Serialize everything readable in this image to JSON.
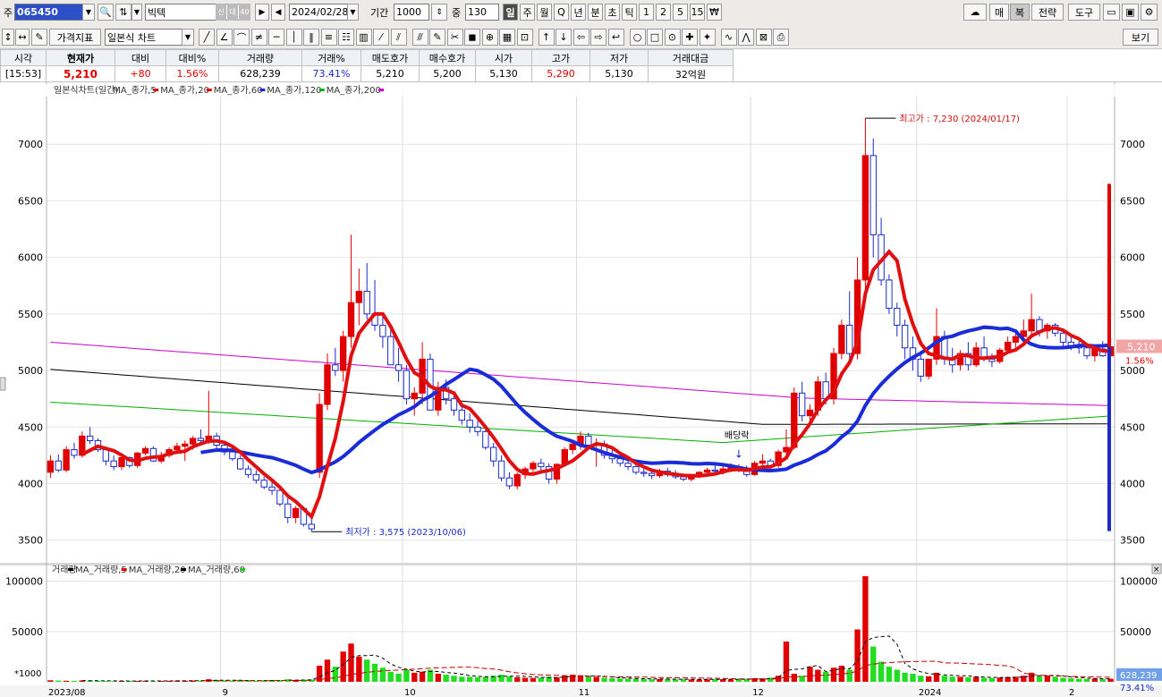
{
  "toolbar": {
    "market_label": "주",
    "code": "065450",
    "name": "빅텍",
    "badges": [
      "신",
      "대",
      "40"
    ],
    "date": "2024/02/28",
    "period_label": "기간",
    "period_value": "1000",
    "count_label": "중",
    "count_value": "130",
    "timeframes": [
      "일",
      "주",
      "월",
      "Q",
      "년",
      "분",
      "초",
      "틱",
      "1",
      "2",
      "5",
      "15",
      "₩"
    ],
    "active_timeframe": "일",
    "right_buttons": [
      "매",
      "복",
      "전략",
      "도구"
    ],
    "indicator_btn": "가격지표",
    "chart_type": "일본식 차트",
    "view_btn": "보기"
  },
  "quote": {
    "headers": [
      "시각",
      "현재가",
      "대비",
      "대비%",
      "거래량",
      "거래%",
      "매도호가",
      "매수호가",
      "시가",
      "고가",
      "저가",
      "거래대금"
    ],
    "values": [
      "[15:53]",
      "5,210",
      "+80",
      "1.56%",
      "628,239",
      "73.41%",
      "5,210",
      "5,200",
      "5,130",
      "5,290",
      "5,130",
      "32억원"
    ]
  },
  "chart_data": {
    "type": "candlestick",
    "price_legend": [
      "일본식차트(일간)",
      "MA_종가,5",
      "MA_종가,20",
      "MA_종가,60",
      "MA_종가,120",
      "MA_종가,200"
    ],
    "volume_legend": [
      "거래량",
      "MA_거래량,5",
      "MA_거래량,20",
      "MA_거래량,60"
    ],
    "price_ticks": [
      3500,
      4000,
      4500,
      5000,
      5500,
      6000,
      6500,
      7000
    ],
    "volume_ticks": [
      "50000",
      "100000"
    ],
    "volume_unit": "*1000",
    "x_labels": [
      "2023/08",
      "9",
      "10",
      "11",
      "12",
      "2024",
      "2"
    ],
    "high_note": "최고가 : 7,230 (2024/01/17)",
    "low_note": "최저가 : 3,575 (2023/10/06)",
    "dividend_note": "배당락",
    "current_price": "5,210",
    "current_pct": "1.56%",
    "current_volume": "628,239",
    "current_volume_pct": "73.41%",
    "ohlc": [
      [
        4100,
        4250,
        4050,
        4200
      ],
      [
        4200,
        4260,
        4100,
        4120
      ],
      [
        4120,
        4330,
        4100,
        4300
      ],
      [
        4300,
        4360,
        4220,
        4250
      ],
      [
        4250,
        4460,
        4230,
        4420
      ],
      [
        4420,
        4500,
        4350,
        4380
      ],
      [
        4380,
        4400,
        4280,
        4300
      ],
      [
        4300,
        4330,
        4160,
        4200
      ],
      [
        4200,
        4250,
        4120,
        4150
      ],
      [
        4150,
        4250,
        4120,
        4230
      ],
      [
        4230,
        4240,
        4140,
        4160
      ],
      [
        4160,
        4280,
        4140,
        4270
      ],
      [
        4270,
        4330,
        4250,
        4310
      ],
      [
        4310,
        4330,
        4190,
        4200
      ],
      [
        4200,
        4280,
        4180,
        4250
      ],
      [
        4250,
        4320,
        4230,
        4300
      ],
      [
        4300,
        4360,
        4270,
        4330
      ],
      [
        4330,
        4380,
        4200,
        4350
      ],
      [
        4350,
        4420,
        4300,
        4400
      ],
      [
        4400,
        4480,
        4350,
        4380
      ],
      [
        4380,
        4820,
        4350,
        4420
      ],
      [
        4420,
        4450,
        4300,
        4340
      ],
      [
        4340,
        4380,
        4250,
        4280
      ],
      [
        4280,
        4310,
        4200,
        4220
      ],
      [
        4220,
        4250,
        4120,
        4130
      ],
      [
        4130,
        4160,
        4050,
        4080
      ],
      [
        4080,
        4120,
        4000,
        4030
      ],
      [
        4030,
        4060,
        3950,
        3970
      ],
      [
        3970,
        4010,
        3900,
        3940
      ],
      [
        3940,
        3980,
        3800,
        3820
      ],
      [
        3820,
        3880,
        3650,
        3700
      ],
      [
        3700,
        3800,
        3650,
        3780
      ],
      [
        3780,
        3800,
        3620,
        3640
      ],
      [
        3640,
        3700,
        3575,
        3600
      ],
      [
        4100,
        4800,
        4050,
        4700
      ],
      [
        4700,
        5150,
        4650,
        5050
      ],
      [
        5050,
        5200,
        4950,
        5000
      ],
      [
        5000,
        5350,
        4900,
        5300
      ],
      [
        5300,
        6200,
        5200,
        5600
      ],
      [
        5600,
        5900,
        5400,
        5700
      ],
      [
        5700,
        5950,
        5450,
        5500
      ],
      [
        5500,
        5800,
        5350,
        5400
      ],
      [
        5400,
        5500,
        5200,
        5300
      ],
      [
        5300,
        5400,
        5100,
        5050
      ],
      [
        5050,
        5200,
        4900,
        5000
      ],
      [
        5000,
        5050,
        4700,
        4750
      ],
      [
        4750,
        4850,
        4600,
        4800
      ],
      [
        4800,
        5250,
        4700,
        5100
      ],
      [
        5100,
        5150,
        4700,
        4650
      ],
      [
        4650,
        4900,
        4600,
        4850
      ],
      [
        4850,
        4920,
        4700,
        4750
      ],
      [
        4750,
        4800,
        4600,
        4650
      ],
      [
        4650,
        4700,
        4520,
        4560
      ],
      [
        4560,
        4620,
        4450,
        4500
      ],
      [
        4500,
        4560,
        4420,
        4460
      ],
      [
        4460,
        4480,
        4300,
        4320
      ],
      [
        4320,
        4360,
        4150,
        4200
      ],
      [
        4200,
        4250,
        4020,
        4050
      ],
      [
        4050,
        4100,
        3950,
        3980
      ],
      [
        3980,
        4100,
        3950,
        4080
      ],
      [
        4080,
        4150,
        4040,
        4130
      ],
      [
        4130,
        4200,
        4100,
        4180
      ],
      [
        4180,
        4220,
        4100,
        4150
      ],
      [
        4150,
        4180,
        4000,
        4040
      ],
      [
        4040,
        4180,
        4000,
        4170
      ],
      [
        4170,
        4320,
        4150,
        4300
      ],
      [
        4300,
        4380,
        4260,
        4350
      ],
      [
        4350,
        4460,
        4300,
        4420
      ],
      [
        4420,
        4450,
        4320,
        4340
      ],
      [
        4340,
        4400,
        4150,
        4350
      ],
      [
        4350,
        4380,
        4220,
        4250
      ],
      [
        4250,
        4300,
        4180,
        4220
      ],
      [
        4220,
        4260,
        4150,
        4180
      ],
      [
        4180,
        4220,
        4120,
        4150
      ],
      [
        4150,
        4180,
        4080,
        4100
      ],
      [
        4100,
        4140,
        4060,
        4090
      ],
      [
        4090,
        4120,
        4040,
        4070
      ],
      [
        4070,
        4130,
        4050,
        4110
      ],
      [
        4110,
        4140,
        4060,
        4080
      ],
      [
        4080,
        4120,
        4040,
        4060
      ],
      [
        4060,
        4090,
        4020,
        4040
      ],
      [
        4040,
        4080,
        4020,
        4060
      ],
      [
        4060,
        4110,
        4050,
        4100
      ],
      [
        4100,
        4140,
        4080,
        4120
      ],
      [
        4120,
        4160,
        4090,
        4110
      ],
      [
        4110,
        4150,
        4080,
        4130
      ],
      [
        4130,
        4180,
        4100,
        4150
      ],
      [
        4150,
        4170,
        4100,
        4120
      ],
      [
        4120,
        4160,
        4060,
        4080
      ],
      [
        4080,
        4200,
        4070,
        4180
      ],
      [
        4180,
        4260,
        4150,
        4200
      ],
      [
        4200,
        4220,
        4140,
        4160
      ],
      [
        4160,
        4300,
        4140,
        4280
      ],
      [
        4280,
        4480,
        4250,
        4320
      ],
      [
        4320,
        4850,
        4300,
        4800
      ],
      [
        4800,
        4900,
        4550,
        4600
      ],
      [
        4600,
        4700,
        4550,
        4650
      ],
      [
        4650,
        4950,
        4600,
        4900
      ],
      [
        4900,
        4980,
        4700,
        4750
      ],
      [
        4750,
        5200,
        4700,
        5150
      ],
      [
        5150,
        5450,
        5100,
        5400
      ],
      [
        5400,
        5700,
        5100,
        5150
      ],
      [
        5150,
        6000,
        5100,
        5800
      ],
      [
        5800,
        7230,
        5700,
        6900
      ],
      [
        6900,
        7050,
        6000,
        6200
      ],
      [
        6200,
        6350,
        5750,
        5800
      ],
      [
        5800,
        5850,
        5500,
        5550
      ],
      [
        5550,
        5600,
        5300,
        5400
      ],
      [
        5400,
        5450,
        5100,
        5200
      ],
      [
        5200,
        5300,
        5000,
        5100
      ],
      [
        5100,
        5150,
        4900,
        4950
      ],
      [
        4950,
        5100,
        4920,
        5100
      ],
      [
        5100,
        5550,
        5050,
        5300
      ],
      [
        5300,
        5350,
        5050,
        5100
      ],
      [
        5100,
        5200,
        4980,
        5050
      ],
      [
        5050,
        5180,
        5000,
        5150
      ],
      [
        5150,
        5250,
        5000,
        5050
      ],
      [
        5050,
        5250,
        5030,
        5200
      ],
      [
        5200,
        5300,
        5080,
        5100
      ],
      [
        5100,
        5150,
        5030,
        5080
      ],
      [
        5080,
        5200,
        5060,
        5180
      ],
      [
        5180,
        5300,
        5150,
        5250
      ],
      [
        5250,
        5350,
        5200,
        5300
      ],
      [
        5300,
        5450,
        5250,
        5350
      ],
      [
        5350,
        5680,
        5300,
        5450
      ],
      [
        5450,
        5480,
        5300,
        5350
      ],
      [
        5350,
        5420,
        5280,
        5400
      ],
      [
        5400,
        5420,
        5300,
        5330
      ],
      [
        5330,
        5350,
        5200,
        5250
      ],
      [
        5250,
        5300,
        5180,
        5220
      ],
      [
        5220,
        5260,
        5150,
        5200
      ],
      [
        5200,
        5240,
        5100,
        5130
      ],
      [
        5130,
        5220,
        5080,
        5190
      ],
      [
        5190,
        5260,
        5120,
        5130
      ],
      [
        5130,
        5290,
        5130,
        5210
      ]
    ],
    "volume": [
      1500,
      1200,
      1000,
      900,
      1400,
      1100,
      900,
      800,
      700,
      900,
      800,
      900,
      1000,
      800,
      900,
      1000,
      1200,
      1100,
      1300,
      1200,
      2500,
      1500,
      1200,
      1100,
      1300,
      1200,
      1100,
      1300,
      1200,
      1500,
      2500,
      1800,
      2000,
      2200,
      16000,
      22000,
      15000,
      30000,
      38000,
      25000,
      22000,
      18000,
      14000,
      10000,
      8000,
      12000,
      9000,
      10000,
      12000,
      8000,
      7000,
      6000,
      5000,
      5000,
      4500,
      5000,
      6000,
      7000,
      5500,
      4500,
      4000,
      3800,
      4000,
      5000,
      4500,
      6000,
      7000,
      6500,
      5000,
      4500,
      4000,
      3500,
      3200,
      3000,
      3200,
      2800,
      2500,
      2700,
      2600,
      2400,
      2500,
      2300,
      2200,
      2400,
      2500,
      2600,
      2300,
      2400,
      3000,
      3500,
      3200,
      4000,
      6000,
      40000,
      8000,
      6000,
      15000,
      12000,
      10000,
      14000,
      16000,
      12000,
      52000,
      105000,
      35000,
      20000,
      15000,
      12000,
      9000,
      8000,
      6000,
      5500,
      9000,
      6000,
      5000,
      5000,
      4500,
      5000,
      4000,
      3800,
      4200,
      4800,
      5000,
      6000,
      9000,
      5500,
      6000,
      5000,
      4000,
      3500,
      3000,
      2800,
      3200,
      2600,
      3000
    ],
    "colors": {
      "up": "#e00000",
      "down": "#1a2bc8",
      "ma5": "#e01010",
      "ma20": "#e01010",
      "ma60": "#1a2bd8",
      "ma120": "#00b000",
      "ma200": "#cc00cc",
      "vol_up": "#e00000",
      "vol_down": "#22dd22"
    }
  }
}
